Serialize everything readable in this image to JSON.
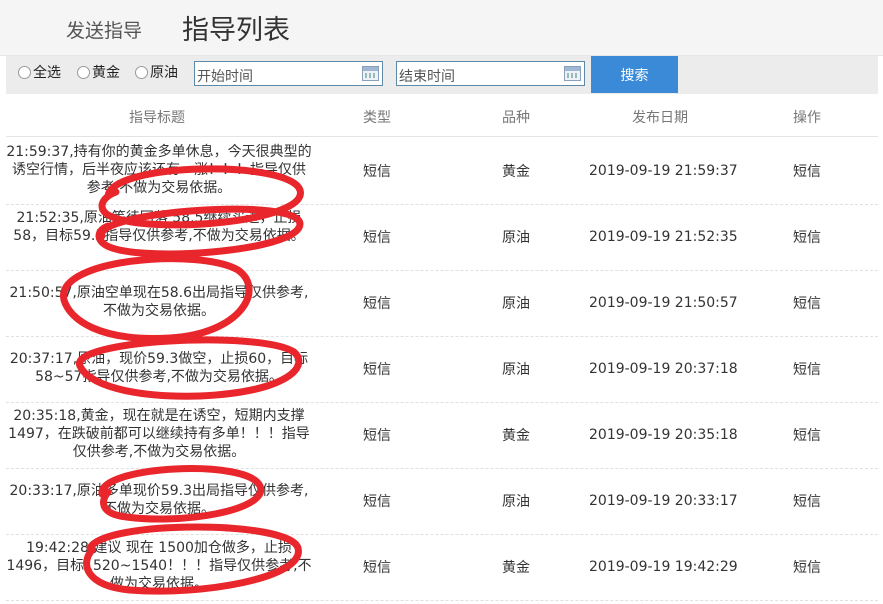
{
  "header": {
    "tab_send": "发送指导",
    "tab_list": "指导列表"
  },
  "filter": {
    "radios": [
      "全选",
      "黄金",
      "原油"
    ],
    "start_placeholder": "开始时间",
    "end_placeholder": "结束时间",
    "search_label": "搜索"
  },
  "table": {
    "headers": [
      "指导标题",
      "类型",
      "品种",
      "发布日期",
      "操作"
    ],
    "rows": [
      {
        "title": "21:59:37,持有你的黄金多单休息，今天很典型的诱空行情，后半夜应该还有一涨！！！指导仅供参考,不做为交易依据。",
        "type": "短信",
        "kind": "黄金",
        "date": "2019-09-19 21:59:37",
        "op": "短信"
      },
      {
        "title": "21:52:35,原油等待回落 58.5继续买进，止损58，目标59.5指导仅供参考,不做为交易依据。",
        "type": "短信",
        "kind": "原油",
        "date": "2019-09-19 21:52:35",
        "op": "短信"
      },
      {
        "title": "21:50:57,原油空单现在58.6出局指导仅供参考,不做为交易依据。",
        "type": "短信",
        "kind": "原油",
        "date": "2019-09-19 21:50:57",
        "op": "短信"
      },
      {
        "title": "20:37:17,原油，现价59.3做空，止损60，目标58~57指导仅供参考,不做为交易依据。",
        "type": "短信",
        "kind": "原油",
        "date": "2019-09-19 20:37:18",
        "op": "短信"
      },
      {
        "title": "20:35:18,黄金，现在就是在诱空，短期内支撑1497，在跌破前都可以继续持有多单！！！指导仅供参考,不做为交易依据。",
        "type": "短信",
        "kind": "黄金",
        "date": "2019-09-19 20:35:18",
        "op": "短信"
      },
      {
        "title": "20:33:17,原油多单现价59.3出局指导仅供参考,不做为交易依据。",
        "type": "短信",
        "kind": "原油",
        "date": "2019-09-19 20:33:17",
        "op": "短信"
      },
      {
        "title": "19:42:28,建议 现在 1500加仓做多，止损1496，目标1520~1540！！！指导仅供参考,不做为交易依据。",
        "type": "短信",
        "kind": "黄金",
        "date": "2019-09-19 19:42:29",
        "op": "短信"
      }
    ]
  },
  "colors": {
    "accent": "#3a8ad8",
    "annotation": "#e8262b"
  }
}
